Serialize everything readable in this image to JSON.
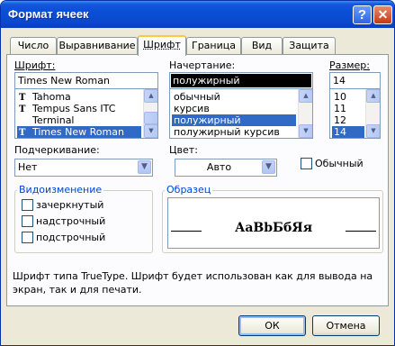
{
  "window": {
    "title": "Формат ячеек"
  },
  "titlebar": {
    "help": "?",
    "close": "✕"
  },
  "tabs": [
    {
      "label": "Число"
    },
    {
      "label": "Выравнивание"
    },
    {
      "label": "Шрифт"
    },
    {
      "label": "Граница"
    },
    {
      "label": "Вид"
    },
    {
      "label": "Защита"
    }
  ],
  "font": {
    "label": "Шрифт:",
    "value": "Times New Roman",
    "items": [
      {
        "name": "Tahoma",
        "truetype": true
      },
      {
        "name": "Tempus Sans ITC",
        "truetype": true
      },
      {
        "name": "Terminal",
        "truetype": false
      },
      {
        "name": "Times New Roman",
        "truetype": true,
        "selected": true
      }
    ]
  },
  "style": {
    "label": "Начертание:",
    "value": "полужирный",
    "items": [
      {
        "name": "обычный"
      },
      {
        "name": "курсив"
      },
      {
        "name": "полужирный",
        "selected": true
      },
      {
        "name": "полужирный курсив"
      }
    ]
  },
  "size": {
    "label": "Размер:",
    "value": "14",
    "items": [
      {
        "name": "10"
      },
      {
        "name": "11"
      },
      {
        "name": "12"
      },
      {
        "name": "14",
        "selected": true
      }
    ]
  },
  "underline": {
    "label": "Подчеркивание:",
    "value": "Нет"
  },
  "color": {
    "label": "Цвет:",
    "value": "Авто"
  },
  "normal_font": {
    "label": "Обычный",
    "checked": false
  },
  "effects": {
    "title": "Видоизменение",
    "strikethrough": "зачеркнутый",
    "superscript": "надстрочный",
    "subscript": "подстрочный"
  },
  "preview": {
    "title": "Образец",
    "text": "АаВbБбЯя"
  },
  "description": "Шрифт типа TrueType. Шрифт будет использован как для вывода на экран, так и для печати.",
  "buttons": {
    "ok": "ОК",
    "cancel": "Отмена"
  },
  "colors": {
    "titlebar": "#0a4fd8",
    "selection": "#316ac5",
    "group_title": "#0046d5",
    "active_tab_accent": "#ffc83c"
  }
}
